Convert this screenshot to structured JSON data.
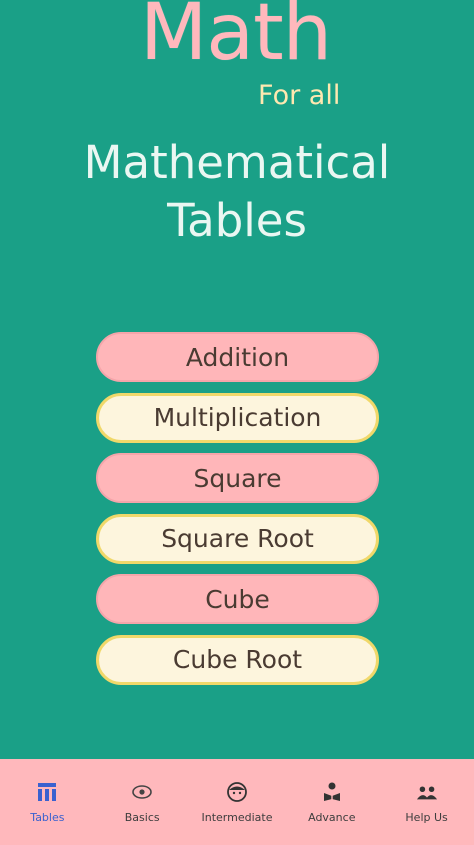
{
  "logo": {
    "title": "Math",
    "subtitle": "For all"
  },
  "heading": {
    "line1": "Mathematical",
    "line2": "Tables"
  },
  "menu": {
    "items": [
      {
        "label": "Addition",
        "style": "pink"
      },
      {
        "label": "Multiplication",
        "style": "cream"
      },
      {
        "label": "Square",
        "style": "pink"
      },
      {
        "label": "Square Root",
        "style": "cream"
      },
      {
        "label": "Cube",
        "style": "pink"
      },
      {
        "label": "Cube Root",
        "style": "cream"
      }
    ]
  },
  "bottom_nav": {
    "items": [
      {
        "label": "Tables",
        "icon": "table-icon",
        "active": true
      },
      {
        "label": "Basics",
        "icon": "eye-icon",
        "active": false
      },
      {
        "label": "Intermediate",
        "icon": "face-icon",
        "active": false
      },
      {
        "label": "Advance",
        "icon": "reader-icon",
        "active": false
      },
      {
        "label": "Help Us",
        "icon": "people-icon",
        "active": false
      }
    ]
  },
  "colors": {
    "background": "#1aa087",
    "logo_pink": "#ffb8bc",
    "logo_cream": "#ffe8b0",
    "button_pink": "#ffb6b9",
    "button_cream": "#fdf5dd",
    "button_cream_border": "#f0d86a",
    "nav_background": "#ffb8bc",
    "nav_active": "#3a61cf"
  }
}
